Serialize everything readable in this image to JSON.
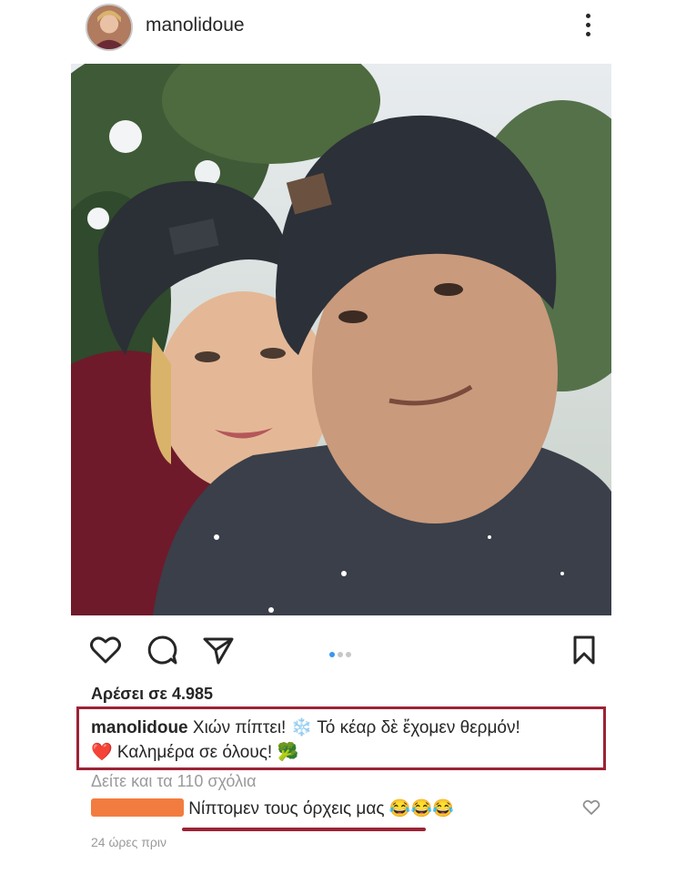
{
  "post": {
    "username": "manolidoue",
    "likes_text": "Αρέσει σε 4.985",
    "caption": {
      "username": "manolidoue",
      "line1_text": "Χιών πίπτει! ❄️ Τό κέαρ δὲ ἔχομεν θερμόν!",
      "line2_text": "❤️ Καλημέρα σε όλους! 🥦"
    },
    "view_comments_text": "Δείτε και τα 110 σχόλια",
    "comment": {
      "text": "Νίπτομεν τους όρχεις μας 😂😂😂"
    },
    "timestamp": "24 ώρες πριν",
    "carousel": {
      "total": 3,
      "active": 1
    }
  },
  "icons": {
    "avatar": "profile-avatar",
    "more": "more-options-icon",
    "like": "heart-icon",
    "comment": "comment-icon",
    "share": "paper-plane-icon",
    "save": "bookmark-icon",
    "comment_like": "small-heart-icon"
  },
  "colors": {
    "highlight_border": "#9b2335",
    "redaction": "#f27c3f",
    "carousel_active": "#3897f0"
  }
}
